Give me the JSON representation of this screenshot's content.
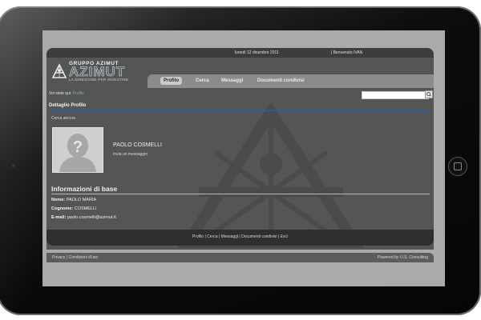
{
  "topbar": {
    "date": "lunedì 12 dicembre 2011",
    "welcome": "| Benvenuto IVAN"
  },
  "logo": {
    "gruppo": "GRUPPO AZIMUT",
    "azimut": "AZIMUT",
    "tagline": "LA DIREZIONE PER INVESTIRE"
  },
  "nav": {
    "items": [
      {
        "label": "Profilo",
        "active": true
      },
      {
        "label": "Cerca",
        "active": false
      },
      {
        "label": "Messaggi",
        "active": false
      },
      {
        "label": "Documenti condivisi",
        "active": false
      }
    ]
  },
  "breadcrumb": {
    "prefix": "Voi siete qui: ",
    "current": "Profilo"
  },
  "search": {
    "placeholder": "",
    "value": ""
  },
  "profile": {
    "section_title": "Dettaglio Profilo",
    "back_link": "Cerca ancora",
    "name": "PAOLO  COSMELLI",
    "send_message": "Invia un messaggio"
  },
  "info": {
    "title": "Informazioni di base",
    "fields": [
      {
        "label": "Nome:",
        "value": "PAOLO MARIA"
      },
      {
        "label": "Cognome:",
        "value": "COSMELLI"
      },
      {
        "label": "E-mail:",
        "value": "paolo.cosmelli@azimut.it"
      }
    ]
  },
  "footer": {
    "links": [
      "Profilo",
      "Cerca",
      "Messaggi",
      "Documenti condivisi",
      "Esci"
    ],
    "privacy": "Privacy",
    "terms": "Condizioni d'uso",
    "powered": "Powered by I.I.S. Consulting"
  },
  "colors": {
    "page_bg": "#545555",
    "nav_bg": "#8a8b8b",
    "accent_line": "#2f5c9b",
    "screen_bg": "#a9aaa9"
  }
}
